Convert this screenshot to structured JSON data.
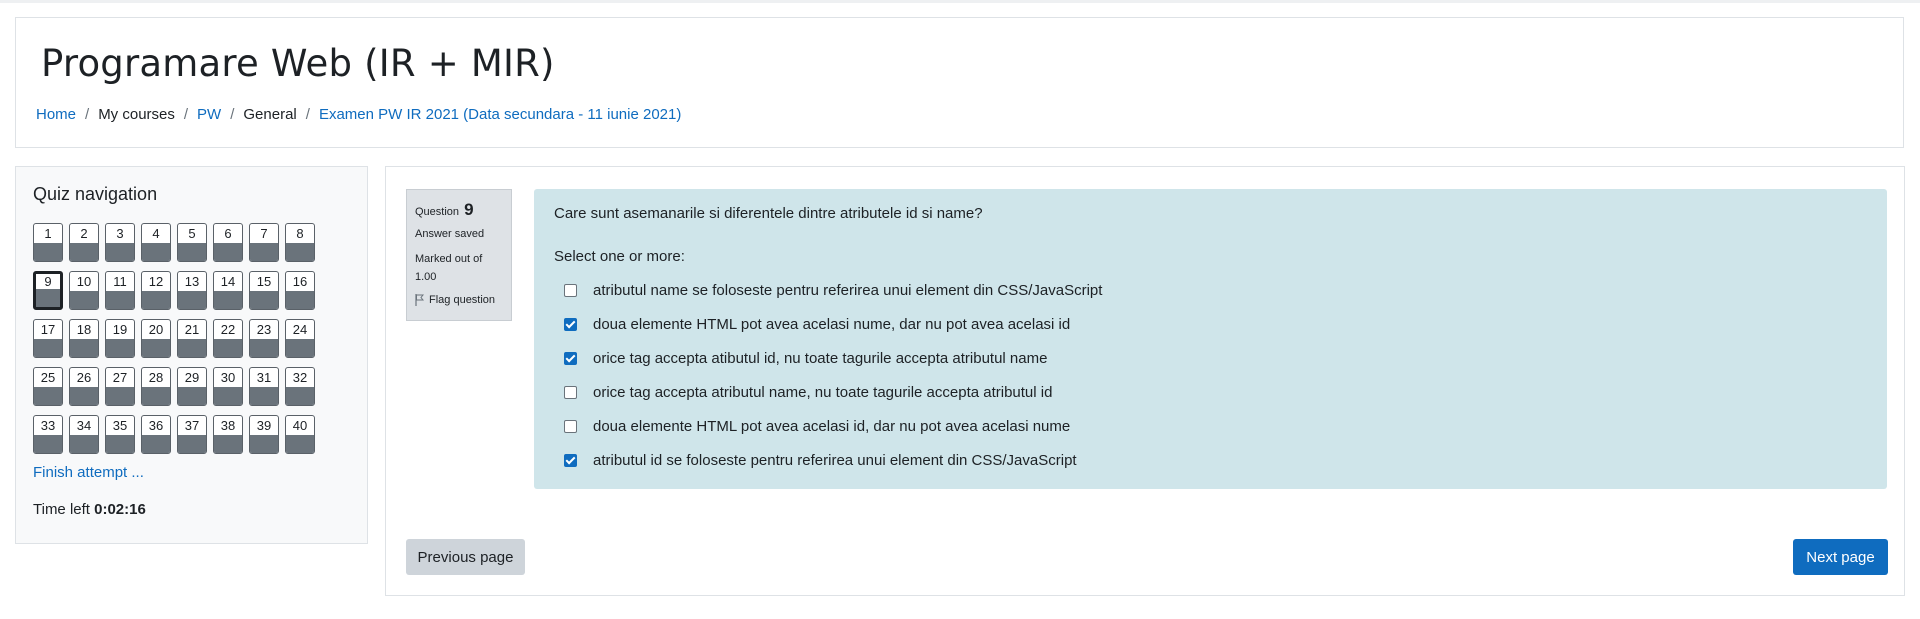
{
  "header": {
    "course_title": "Programare Web (IR + MIR)",
    "breadcrumb": [
      {
        "label": "Home",
        "link": true
      },
      {
        "label": "My courses",
        "link": false
      },
      {
        "label": "PW",
        "link": true
      },
      {
        "label": "General",
        "link": false
      },
      {
        "label": "Examen PW IR 2021 (Data secundara - 11 iunie 2021)",
        "link": true
      }
    ],
    "separator": "/"
  },
  "quiz_nav": {
    "title": "Quiz navigation",
    "questions": [
      "1",
      "2",
      "3",
      "4",
      "5",
      "6",
      "7",
      "8",
      "9",
      "10",
      "11",
      "12",
      "13",
      "14",
      "15",
      "16",
      "17",
      "18",
      "19",
      "20",
      "21",
      "22",
      "23",
      "24",
      "25",
      "26",
      "27",
      "28",
      "29",
      "30",
      "31",
      "32",
      "33",
      "34",
      "35",
      "36",
      "37",
      "38",
      "39",
      "40"
    ],
    "current": "9",
    "finish_label": "Finish attempt ...",
    "time_label": "Time left",
    "time_value": "0:02:16"
  },
  "question": {
    "label": "Question",
    "number": "9",
    "state": "Answer saved",
    "marked_label": "Marked out of",
    "marked_value": "1.00",
    "flag_label": "Flag question",
    "text": "Care sunt asemanarile si diferentele dintre atributele id si name?",
    "prompt": "Select one or more:",
    "options": [
      {
        "label": "atributul name se foloseste pentru referirea unui element din CSS/JavaScript",
        "checked": false
      },
      {
        "label": "doua elemente HTML pot avea acelasi nume, dar nu pot avea acelasi id",
        "checked": true
      },
      {
        "label": "orice tag accepta atibutul id, nu toate tagurile accepta atributul name",
        "checked": true
      },
      {
        "label": "orice tag accepta atributul name, nu toate tagurile accepta atributul id",
        "checked": false
      },
      {
        "label": "doua elemente HTML pot avea acelasi id, dar nu pot avea acelasi nume",
        "checked": false
      },
      {
        "label": "atributul id se foloseste pentru referirea unui element din CSS/JavaScript",
        "checked": true
      }
    ]
  },
  "actions": {
    "previous_label": "Previous page",
    "next_label": "Next page"
  },
  "colors": {
    "link": "#0f6cbf",
    "question_bg": "#cfe5ea",
    "nav_fill": "#6a737b"
  }
}
